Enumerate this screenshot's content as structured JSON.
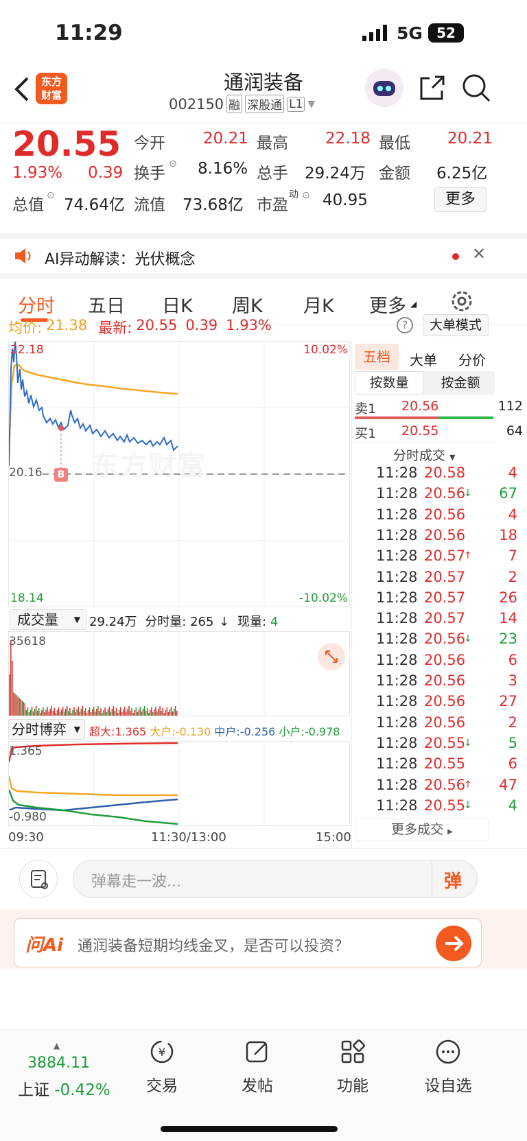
{
  "status": {
    "time": "11:29",
    "network": "5G",
    "battery": "52"
  },
  "nav": {
    "logo_line1": "东方",
    "logo_line2": "财富",
    "title": "通润装备",
    "code": "002150",
    "tags": [
      "融",
      "深股通",
      "L1"
    ]
  },
  "quote": {
    "price": "20.55",
    "change_pct": "1.93%",
    "change": "0.39",
    "rows": [
      [
        {
          "label": "今开",
          "value": "20.21",
          "color": "red"
        },
        {
          "label": "最高",
          "value": "22.18",
          "color": "red"
        },
        {
          "label": "最低",
          "value": "20.21",
          "color": "red"
        }
      ],
      [
        {
          "label": "换手",
          "value": "8.16%",
          "color": "dark"
        },
        {
          "label": "总手",
          "value": "29.24万",
          "color": "dark"
        },
        {
          "label": "金额",
          "value": "6.25亿",
          "color": "dark"
        }
      ],
      [
        {
          "label": "流值",
          "value": "73.68亿",
          "color": "dark"
        },
        {
          "label": "市盈",
          "value": "40.95",
          "color": "dark"
        }
      ]
    ],
    "total_value_label": "总值",
    "total_value": "74.64亿",
    "pe_sup": "动",
    "more": "更多"
  },
  "ai_alert": {
    "text": "AI异动解读：光伏概念"
  },
  "tabs": [
    "分时",
    "五日",
    "日K",
    "周K",
    "月K",
    "更多"
  ],
  "summary": {
    "avg_label": "均价:",
    "avg": "21.38",
    "latest_label": "最新:",
    "latest": "20.55",
    "chg": "0.39",
    "pct": "1.93%",
    "mode": "大单模式"
  },
  "price_chart": {
    "high": "22.18",
    "high_pct": "10.02%",
    "ref": "20.16",
    "low": "18.14",
    "low_pct": "-10.02%",
    "marker": "B",
    "watermark": "东方财富"
  },
  "volume": {
    "selector": "成交量",
    "total": "29.24万",
    "minute_label": "分时量:",
    "minute": "265",
    "now_label": "现量:",
    "now": "4",
    "max": "35618"
  },
  "game": {
    "selector": "分时博弈",
    "chaoda": "超大:1.365",
    "dahu": "大户:-0.130",
    "zhonghu": "中户:-0.256",
    "xiaohu": "小户:-0.978",
    "top": "1.365",
    "bottom": "-0.980"
  },
  "time_axis": {
    "start": "09:30",
    "mid": "11:30/13:00",
    "end": "15:00"
  },
  "side": {
    "tabs": [
      "五档",
      "大单",
      "分价"
    ],
    "subtabs": [
      "按数量",
      "按金额"
    ],
    "sell1": {
      "label": "卖1",
      "price": "20.56",
      "qty": "112"
    },
    "buy1": {
      "label": "买1",
      "price": "20.55",
      "qty": "64"
    },
    "trades_title": "分时成交",
    "trades": [
      {
        "time": "11:28",
        "price": "20.58",
        "arrow": "",
        "qty": "4",
        "qc": "red"
      },
      {
        "time": "11:28",
        "price": "20.56",
        "arrow": "↓",
        "qty": "67",
        "qc": "green"
      },
      {
        "time": "11:28",
        "price": "20.56",
        "arrow": "",
        "qty": "4",
        "qc": "red"
      },
      {
        "time": "11:28",
        "price": "20.56",
        "arrow": "",
        "qty": "18",
        "qc": "red"
      },
      {
        "time": "11:28",
        "price": "20.57",
        "arrow": "↑",
        "qty": "7",
        "qc": "red"
      },
      {
        "time": "11:28",
        "price": "20.57",
        "arrow": "",
        "qty": "2",
        "qc": "red"
      },
      {
        "time": "11:28",
        "price": "20.57",
        "arrow": "",
        "qty": "26",
        "qc": "red"
      },
      {
        "time": "11:28",
        "price": "20.57",
        "arrow": "",
        "qty": "14",
        "qc": "red"
      },
      {
        "time": "11:28",
        "price": "20.56",
        "arrow": "↓",
        "qty": "23",
        "qc": "green"
      },
      {
        "time": "11:28",
        "price": "20.56",
        "arrow": "",
        "qty": "6",
        "qc": "red"
      },
      {
        "time": "11:28",
        "price": "20.56",
        "arrow": "",
        "qty": "3",
        "qc": "red"
      },
      {
        "time": "11:28",
        "price": "20.56",
        "arrow": "",
        "qty": "27",
        "qc": "red"
      },
      {
        "time": "11:28",
        "price": "20.56",
        "arrow": "",
        "qty": "2",
        "qc": "red"
      },
      {
        "time": "11:28",
        "price": "20.55",
        "arrow": "↓",
        "qty": "5",
        "qc": "green"
      },
      {
        "time": "11:28",
        "price": "20.55",
        "arrow": "",
        "qty": "6",
        "qc": "red"
      },
      {
        "time": "11:28",
        "price": "20.56",
        "arrow": "↑",
        "qty": "47",
        "qc": "red"
      },
      {
        "time": "11:28",
        "price": "20.55",
        "arrow": "↓",
        "qty": "4",
        "qc": "green"
      }
    ],
    "more_trades": "更多成交"
  },
  "comment": {
    "placeholder": "弹幕走一波...",
    "dan": "弹"
  },
  "ask_ai": {
    "logo": "问Ai",
    "text": "通润装备短期均线金叉，是否可以投资？"
  },
  "bottom": {
    "index_value": "3884.11",
    "index_name": "上证",
    "index_pct": "-0.42%",
    "items": [
      "交易",
      "发帖",
      "功能",
      "设自选"
    ]
  }
}
